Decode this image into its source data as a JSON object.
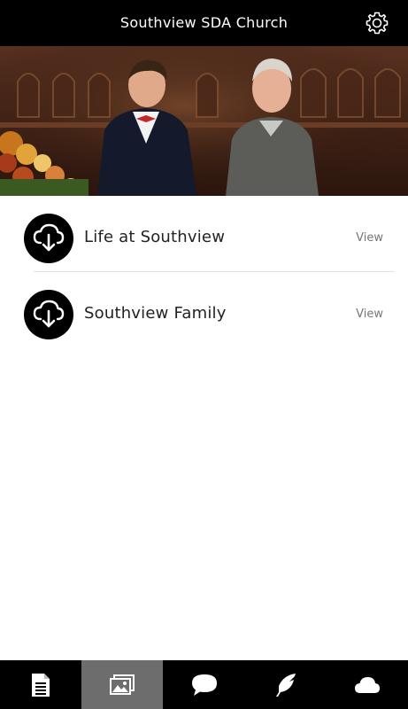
{
  "header": {
    "title": "Southview SDA Church",
    "settings_icon": "gear-icon"
  },
  "hero": {
    "description_icon": "photo-banner"
  },
  "list": {
    "items": [
      {
        "label": "Life at Southview",
        "action": "View",
        "icon": "cloud-download-icon"
      },
      {
        "label": "Southview Family",
        "action": "View",
        "icon": "cloud-download-icon"
      }
    ]
  },
  "tabbar": {
    "active_index": 1,
    "tabs": [
      {
        "icon": "document-icon"
      },
      {
        "icon": "image-gallery-icon"
      },
      {
        "icon": "chat-bubble-icon"
      },
      {
        "icon": "feather-icon"
      },
      {
        "icon": "cloud-icon"
      }
    ]
  },
  "colors": {
    "header_bg": "#000000",
    "tabbar_bg": "#000000",
    "active_tab_bg": "#6d6d6d",
    "text": "#222222",
    "muted": "#777777"
  }
}
